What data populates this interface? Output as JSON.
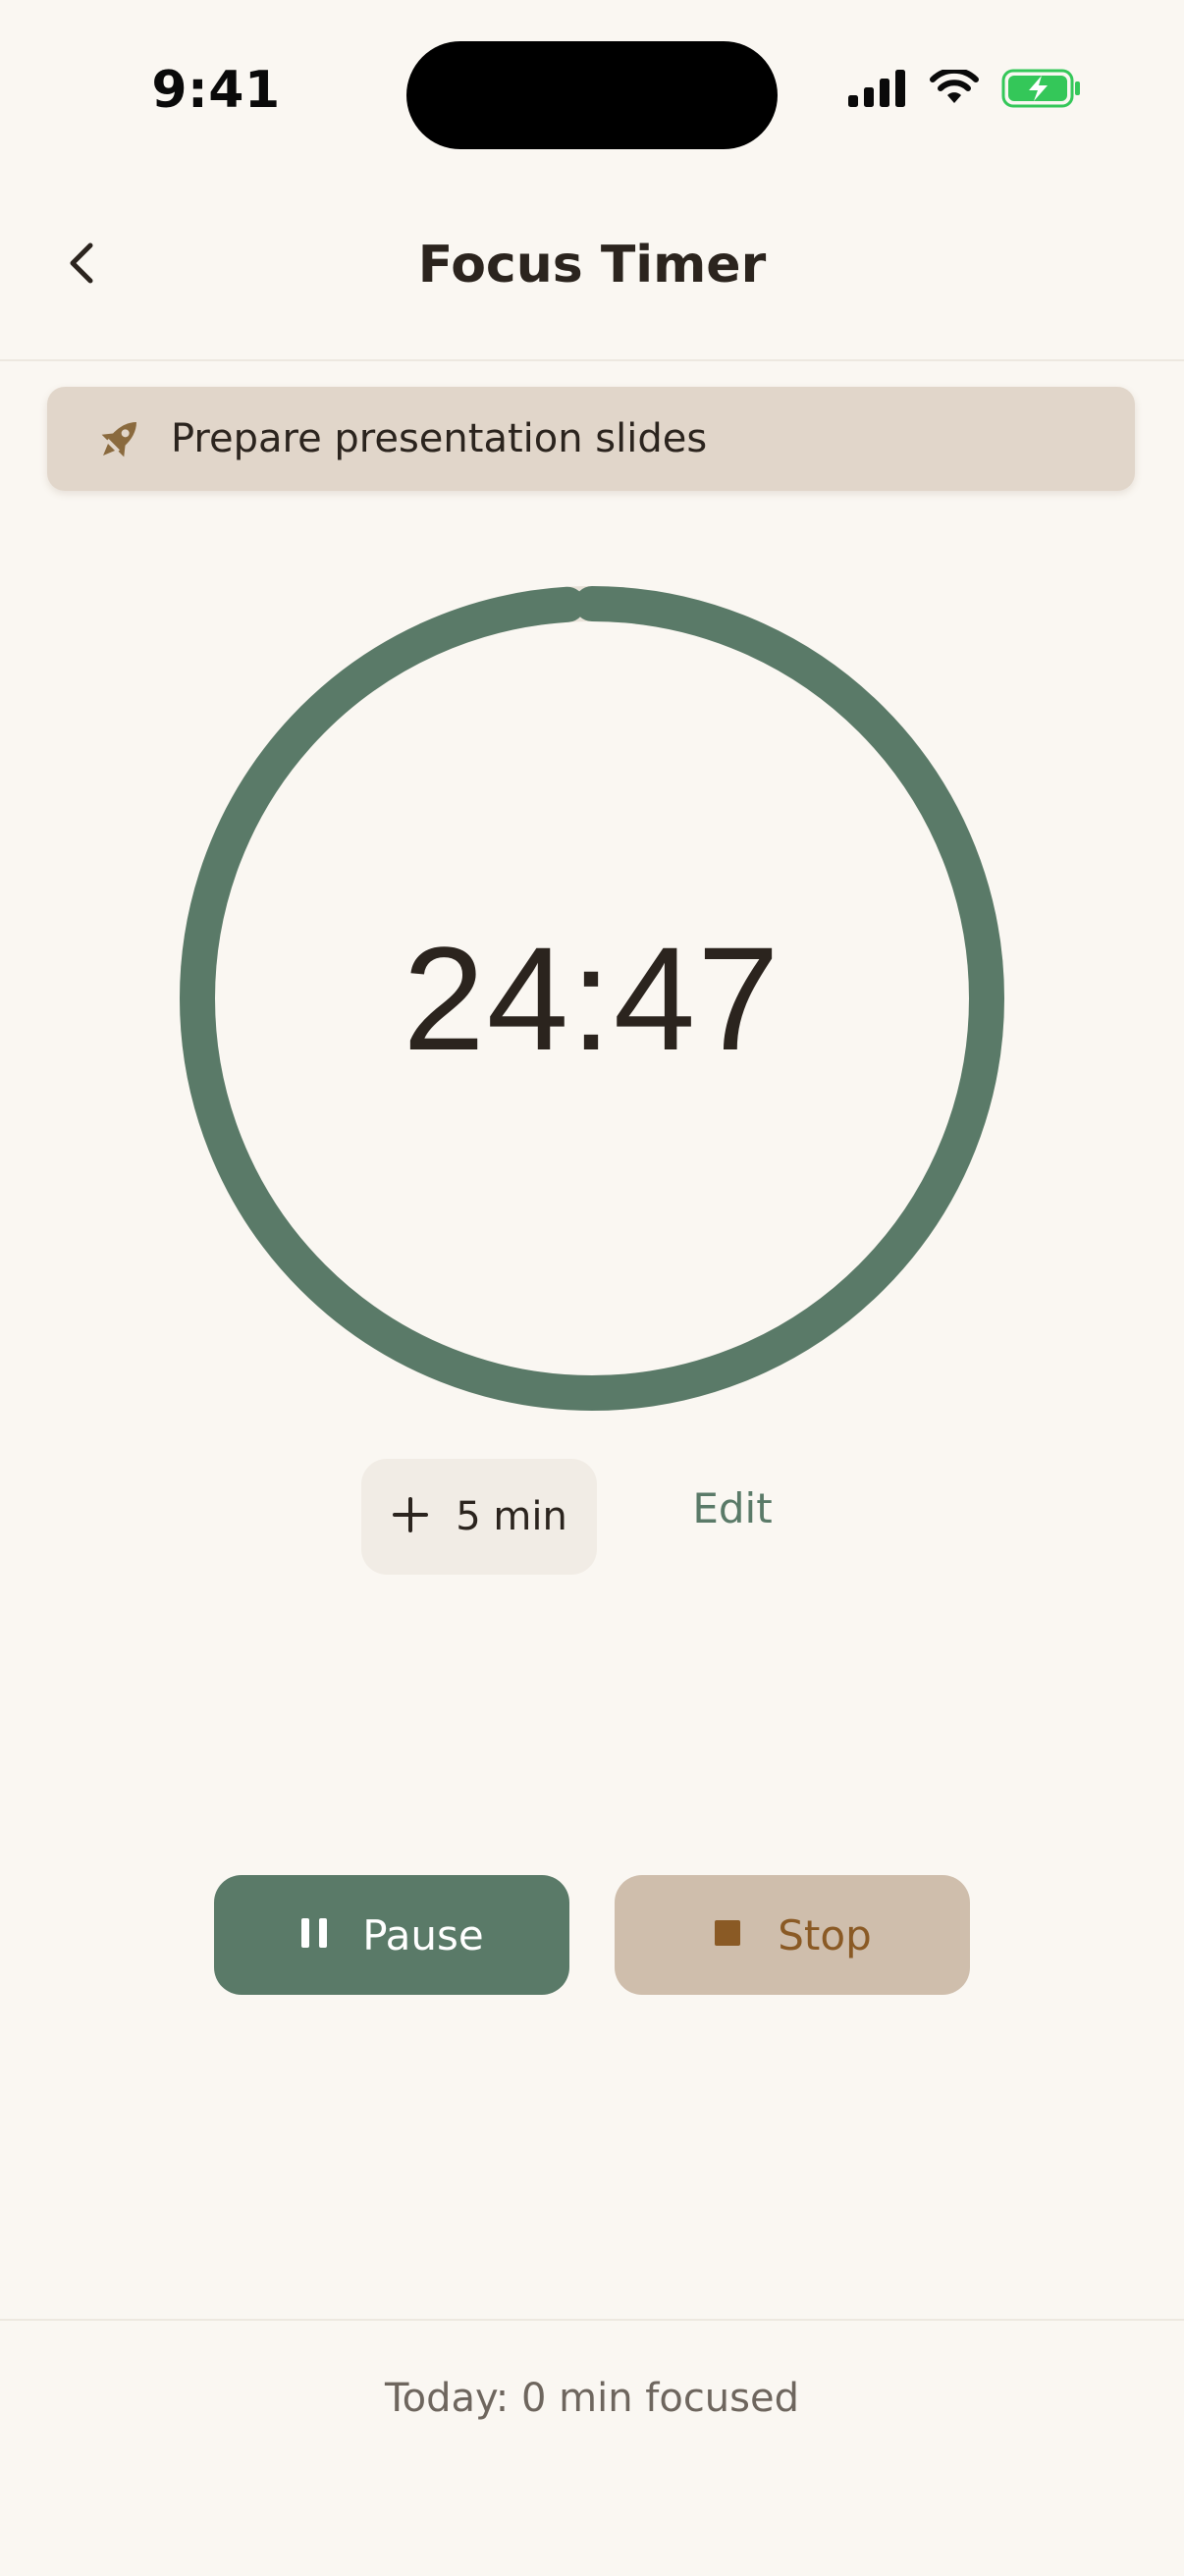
{
  "status_bar": {
    "time": "9:41",
    "icons": [
      "cellular-signal-icon",
      "wifi-icon",
      "battery-charging-icon"
    ]
  },
  "header": {
    "back_icon": "chevron-left-icon",
    "title": "Focus Timer"
  },
  "task": {
    "icon": "rocket-icon",
    "label": "Prepare presentation slides"
  },
  "timer": {
    "remaining": "24:47",
    "progress_fraction": 0.99
  },
  "adjust": {
    "add_icon": "plus-icon",
    "add_label": "5 min",
    "edit_label": "Edit"
  },
  "controls": {
    "pause_icon": "pause-icon",
    "pause_label": "Pause",
    "stop_icon": "stop-icon",
    "stop_label": "Stop"
  },
  "footer": {
    "summary": "Today: 0 min focused"
  },
  "colors": {
    "background": "#FAF7F2",
    "accent_green": "#5A7A68",
    "stop_bg": "#CFBEAC",
    "stop_text": "#8A5A25",
    "banner_bg": "#E1D6CA",
    "rocket": "#8A6A3E",
    "battery_green": "#34C759"
  }
}
